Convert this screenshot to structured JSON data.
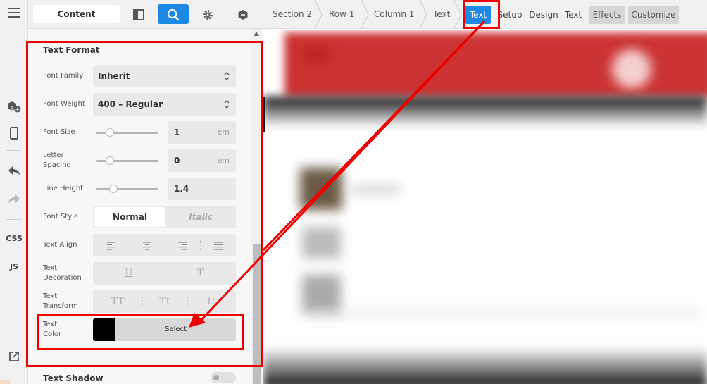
{
  "topbar": {
    "content_label": "Content",
    "icons": [
      "layout-icon",
      "search-icon",
      "gear-icon",
      "shield-icon"
    ]
  },
  "breadcrumb": [
    "Section 2",
    "Row 1",
    "Column 1",
    "Text"
  ],
  "tabs": [
    {
      "label": "Text",
      "active": true
    },
    {
      "label": "Setup"
    },
    {
      "label": "Design"
    },
    {
      "label": "Text"
    },
    {
      "label": "Effects"
    },
    {
      "label": "Customize"
    }
  ],
  "rail": {
    "css": "CSS",
    "js": "JS"
  },
  "panel": {
    "section_title": "Text Format",
    "font_family": {
      "label": "Font Family",
      "value": "Inherit"
    },
    "font_weight": {
      "label": "Font Weight",
      "value": "400 – Regular"
    },
    "font_size": {
      "label": "Font Size",
      "value": "1",
      "unit": "em",
      "slider_fraction": 0.22
    },
    "letter_spacing": {
      "label": "Letter Spacing",
      "value": "0",
      "unit": "em",
      "slider_fraction": 0.22
    },
    "line_height": {
      "label": "Line Height",
      "value": "1.4",
      "slider_fraction": 0.27
    },
    "font_style": {
      "label": "Font Style",
      "options": [
        "Normal",
        "Italic"
      ],
      "selected": "Normal"
    },
    "text_align": {
      "label": "Text Align"
    },
    "text_decoration": {
      "label": "Text Decoration",
      "options": [
        "U",
        "T"
      ]
    },
    "text_transform": {
      "label": "Text Transform",
      "options": [
        "TT",
        "Tt",
        "tt"
      ]
    },
    "text_color": {
      "label": "Text Color",
      "button": "Select",
      "color": "#000000"
    },
    "text_shadow": {
      "label": "Text Shadow",
      "enabled": false
    }
  },
  "colors": {
    "accent": "#1e88e5",
    "annotation": "#e00000"
  }
}
